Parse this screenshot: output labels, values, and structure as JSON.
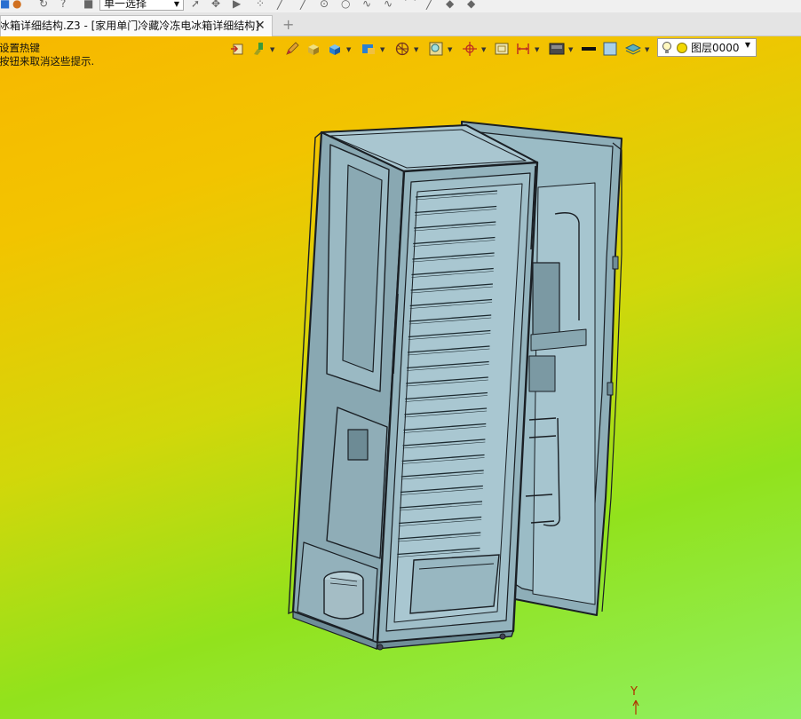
{
  "toolbar": {
    "selection_mode": "单一选择"
  },
  "tabs": [
    {
      "label": "冰箱详细结构.Z3 - [家用单门冷藏冷冻电冰箱详细结构]",
      "active": true
    }
  ],
  "hints": {
    "line1": "设置热键",
    "line2": "按钮来取消这些提示."
  },
  "layer": {
    "name": "图层0000"
  },
  "axis": {
    "y_label": "Y"
  },
  "icons": [
    "redo-icon",
    "help-icon",
    "stop-icon",
    "close-tab-icon",
    "add-tab-icon",
    "lightbulb-icon",
    "dropdown-arrow-icon"
  ],
  "colors": {
    "viewport_top": "#f7b800",
    "viewport_bottom": "#8ff062",
    "model_fill": "#8fb0bb",
    "model_edge": "#1a1f24"
  }
}
